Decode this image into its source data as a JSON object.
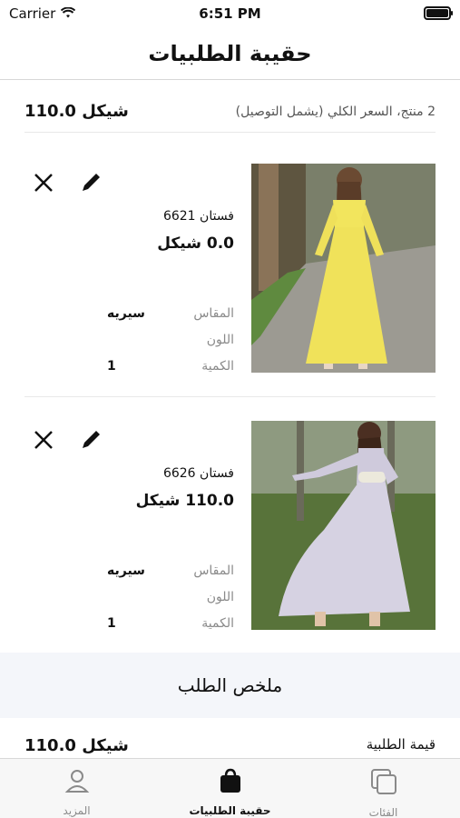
{
  "status_bar": {
    "carrier": "Carrier",
    "time": "6:51 PM"
  },
  "header": {
    "title": "حقيبة الطلبيات"
  },
  "summary": {
    "caption": "2 منتج، السعر الكلي (يشمل التوصيل)",
    "total": "110.0 شيكل"
  },
  "items": [
    {
      "name": "فستان 6621",
      "price": "0.0 شيكل",
      "size_label": "المقاس",
      "size_value": "سيريه",
      "color_label": "اللون",
      "color_value": "",
      "qty_label": "الكمية",
      "qty_value": "1"
    },
    {
      "name": "فستان 6626",
      "price": "110.0 شيكل",
      "size_label": "المقاس",
      "size_value": "سيريه",
      "color_label": "اللون",
      "color_value": "",
      "qty_label": "الكمية",
      "qty_value": "1"
    }
  ],
  "order_summary": {
    "title": "ملخص الطلب",
    "value_label": "قيمة الطلبية",
    "value": "110.0 شيكل"
  },
  "tabs": [
    {
      "label": "المزيد",
      "icon": "person-icon"
    },
    {
      "label": "حقيبة الطلبيات",
      "icon": "bag-icon"
    },
    {
      "label": "الفئات",
      "icon": "categories-icon"
    }
  ],
  "colors": {
    "accent": "#111111",
    "muted": "#8a8a8a",
    "summary_bg": "#f4f6fa"
  }
}
